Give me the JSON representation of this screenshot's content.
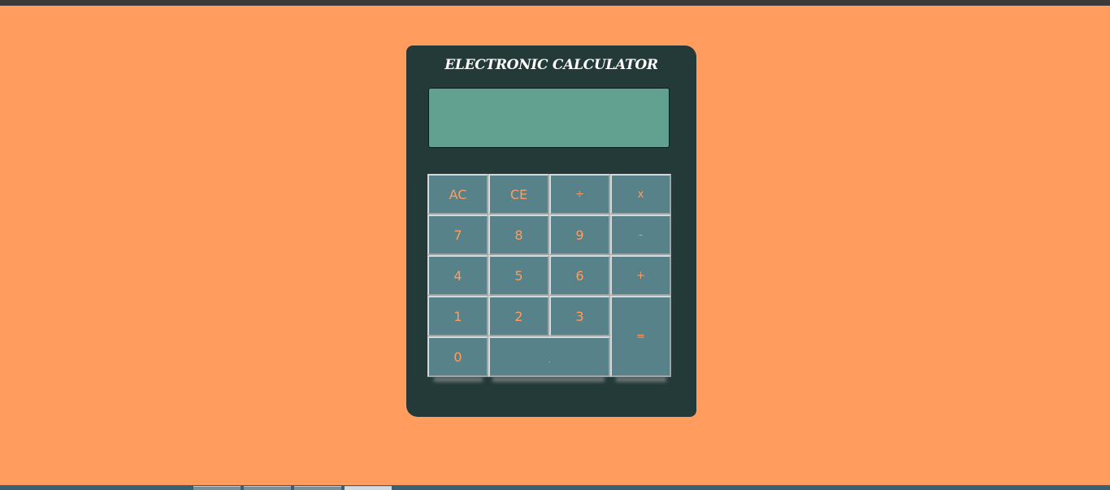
{
  "calculator": {
    "title": "ELECTRONIC CALCULATOR",
    "display_value": "",
    "keys": {
      "ac": "AC",
      "ce": "CE",
      "divide": "÷",
      "multiply": "x",
      "seven": "7",
      "eight": "8",
      "nine": "9",
      "minus": "-",
      "four": "4",
      "five": "5",
      "six": "6",
      "plus": "+",
      "one": "1",
      "two": "2",
      "three": "3",
      "equals": "=",
      "zero": "0",
      "dot": "."
    }
  },
  "colors": {
    "page_background": "#ff9c5e",
    "calculator_body": "#243a38",
    "display_background": "#62a090",
    "key_background": "#58828a",
    "key_text": "#ff9c5e",
    "title_text": "#ffffff"
  }
}
